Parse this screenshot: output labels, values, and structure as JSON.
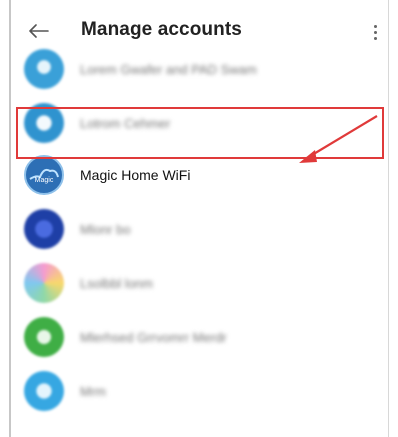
{
  "header": {
    "title": "Manage accounts",
    "back_icon": "back-arrow-icon",
    "more_icon": "more-vert-icon"
  },
  "accounts": [
    {
      "label": "Lorem Gwafer and PAD Swam",
      "avatar_color": "#3aa0d8",
      "blurred": true
    },
    {
      "label": "Lotrom Cehmer",
      "avatar_color": "#2f93cf",
      "blurred": true
    },
    {
      "label": "Magic Home WiFi",
      "avatar_color": "#2d6fb5",
      "blurred": false
    },
    {
      "label": "Mlonr bo",
      "avatar_color": "#1e3fa6",
      "blurred": true
    },
    {
      "label": "Lsolbbl lonm",
      "avatar_color": "#48b2e0",
      "blurred": true
    },
    {
      "label": "Mlerhsed Grrvomrr Merdr",
      "avatar_color": "#3fae45",
      "blurred": true
    },
    {
      "label": "Mrm",
      "avatar_color": "#36a7e2",
      "blurred": true
    }
  ],
  "annotation": {
    "highlight_color": "#e03a3a"
  }
}
